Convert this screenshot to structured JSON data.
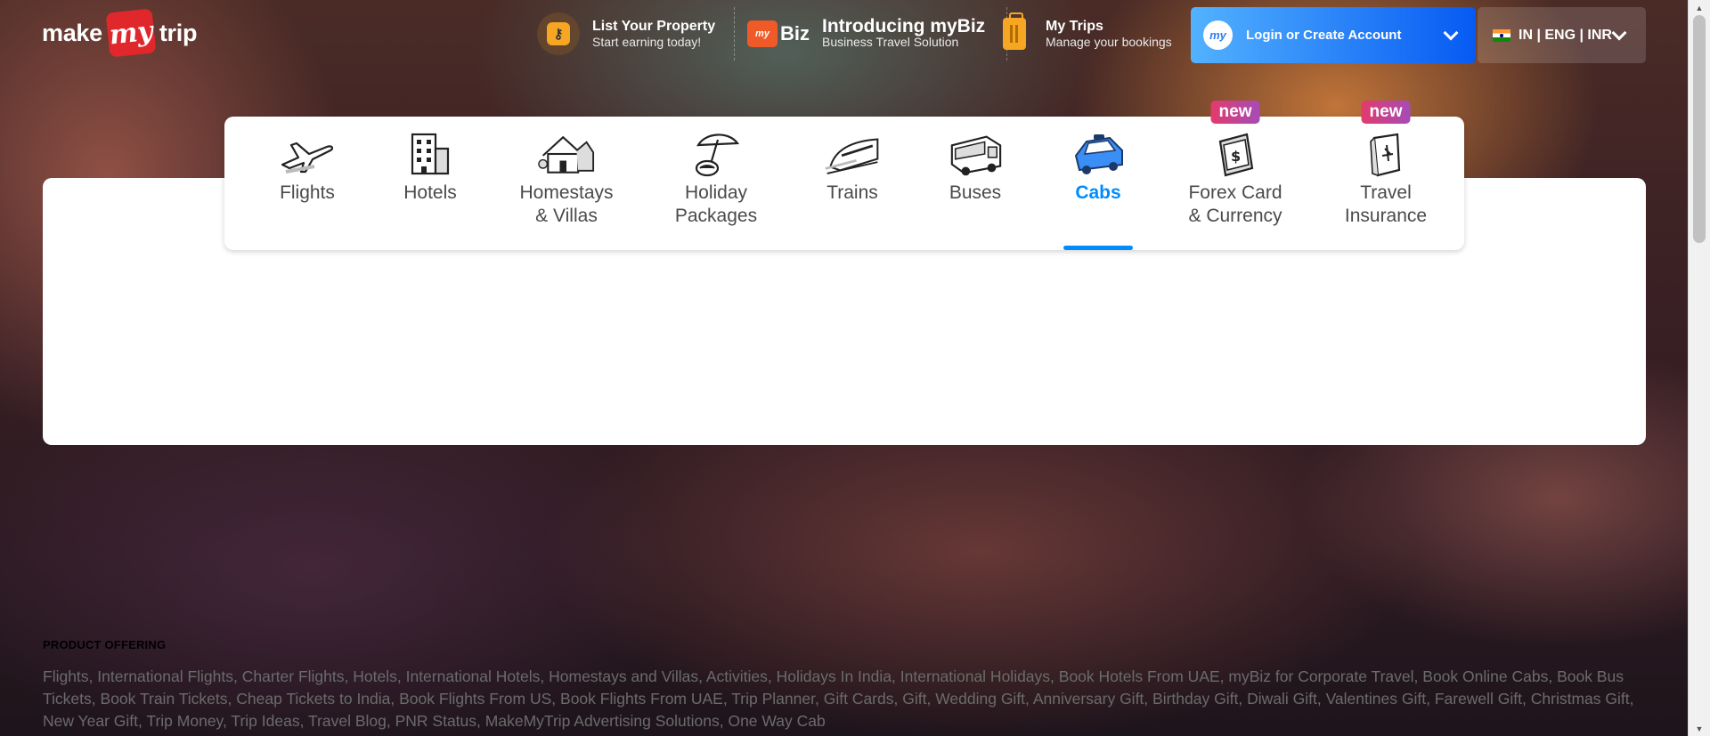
{
  "header": {
    "logo": {
      "make": "make",
      "my": "my",
      "trip": "trip"
    },
    "list_property": {
      "title": "List Your Property",
      "subtitle": "Start earning today!"
    },
    "mybiz": {
      "badge_my": "my",
      "badge_biz": "Biz",
      "title": "Introducing myBiz",
      "subtitle": "Business Travel Solution"
    },
    "my_trips": {
      "title": "My Trips",
      "subtitle": "Manage your bookings"
    },
    "login": {
      "avatar": "my",
      "label": "Login or Create Account"
    },
    "locale": {
      "label": "IN | ENG | INR"
    }
  },
  "nav": {
    "items": [
      {
        "label": "Flights",
        "icon": "plane-icon"
      },
      {
        "label": "Hotels",
        "icon": "building-icon"
      },
      {
        "label": "Homestays\n& Villas",
        "icon": "house-icon"
      },
      {
        "label": "Holiday\nPackages",
        "icon": "umbrella-icon"
      },
      {
        "label": "Trains",
        "icon": "train-icon"
      },
      {
        "label": "Buses",
        "icon": "bus-icon"
      },
      {
        "label": "Cabs",
        "icon": "cab-icon",
        "active": true
      },
      {
        "label": "Forex Card\n& Currency",
        "icon": "forex-card-icon",
        "badge": "new"
      },
      {
        "label": "Travel\nInsurance",
        "icon": "insurance-icon",
        "badge": "new"
      }
    ]
  },
  "footer": {
    "title": "PRODUCT OFFERING",
    "links": [
      "Flights",
      "International Flights",
      "Charter Flights",
      "Hotels",
      "International Hotels",
      "Homestays and Villas",
      "Activities",
      "Holidays In India",
      "International Holidays",
      "Book Hotels From UAE",
      "myBiz for Corporate Travel",
      "Book Online Cabs",
      "Book Bus Tickets",
      "Book Train Tickets",
      "Cheap Tickets to India",
      "Book Flights From US",
      "Book Flights From UAE",
      "Trip Planner",
      "Gift Cards",
      "Gift",
      "Wedding Gift",
      "Anniversary Gift",
      "Birthday Gift",
      "Diwali Gift",
      "Valentines Gift",
      "Farewell Gift",
      "Christmas Gift",
      "New Year Gift",
      "Trip Money",
      "Trip Ideas",
      "Travel Blog",
      "PNR Status",
      "MakeMyTrip Advertising Solutions",
      "One Way Cab"
    ]
  },
  "colors": {
    "accent": "#008cff",
    "login_start": "#53b2fe",
    "login_end": "#065af3",
    "brand_red": "#e0272c",
    "badge_start": "#e23b6b",
    "badge_end": "#a64bb8"
  }
}
